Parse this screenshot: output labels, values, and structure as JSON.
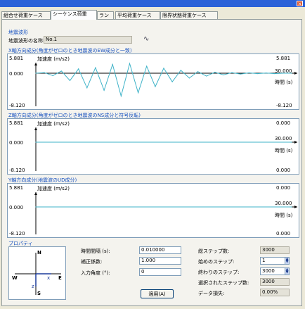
{
  "window": {
    "close_glyph": "✕"
  },
  "tabs": [
    {
      "label": "組合せ荷重ケース"
    },
    {
      "label": "シーケンス荷重"
    },
    {
      "label": "ラン"
    },
    {
      "label": "平均荷重ケース"
    },
    {
      "label": "限界状態荷重ケース"
    }
  ],
  "earthquake": {
    "group_title": "地震波形",
    "name_label": "地震波形の名称:",
    "name_value": "No.1",
    "icon": "waveform-icon"
  },
  "charts": [
    {
      "title": "X軸方向成分(角度がゼロのとき地震波のEW成分と一致)",
      "y_axis_label": "加速度 (m/s2)",
      "x_axis_label": "時間 (s)",
      "y_max_label": "5.881",
      "y_zero_label": "0.000",
      "y_min_label": "-8.120",
      "right_top_label": "5.881",
      "right_bottom_label": "-8.120",
      "x_end_label": "30.000"
    },
    {
      "title": "Z軸方向成分(角度がゼロのとき地震波のNS成分と符号反転)",
      "y_axis_label": "加速度 (m/s2)",
      "x_axis_label": "時間 (s)",
      "y_max_label": "5.881",
      "y_zero_label": "0.000",
      "y_min_label": "-8.120",
      "right_top_label": "0.000",
      "right_bottom_label": "0.000",
      "x_end_label": "30.000"
    },
    {
      "title": "Y軸方向成分(地震波のUD成分)",
      "y_axis_label": "加速度 (m/s2)",
      "x_axis_label": "時間 (s)",
      "y_max_label": "5.881",
      "y_zero_label": "0.000",
      "y_min_label": "-8.120",
      "right_top_label": "0.000",
      "right_bottom_label": "0.000",
      "x_end_label": "30.000"
    }
  ],
  "chart_data": [
    {
      "type": "line",
      "title": "X軸方向成分(角度がゼロのとき地震波のEW成分と一致)",
      "xlabel": "時間 (s)",
      "ylabel": "加速度 (m/s2)",
      "xlim": [
        0,
        30
      ],
      "ylim": [
        -8.12,
        5.881
      ],
      "x": [
        0,
        1,
        2,
        3,
        4,
        5,
        6,
        7,
        8,
        9,
        10,
        11,
        12,
        13,
        14,
        15,
        16,
        17,
        18,
        19,
        20,
        21,
        22,
        23,
        24,
        25,
        26,
        27,
        28,
        29,
        30
      ],
      "series": [
        {
          "values": [
            0,
            0.3,
            -0.6,
            1.2,
            -1.8,
            2.4,
            -3.6,
            3.1,
            -4.2,
            4.9,
            -5.6,
            5.4,
            -4.8,
            3.9,
            -3.3,
            2.8,
            -2.1,
            1.6,
            -1.2,
            0.9,
            -0.7,
            0.5,
            -0.4,
            0.3,
            -0.2,
            0.2,
            -0.1,
            0.1,
            -0.1,
            0,
            0
          ]
        }
      ]
    },
    {
      "type": "line",
      "title": "Z軸方向成分(角度がゼロのとき地震波のNS成分と符号反転)",
      "xlabel": "時間 (s)",
      "ylabel": "加速度 (m/s2)",
      "xlim": [
        0,
        30
      ],
      "ylim": [
        -8.12,
        5.881
      ],
      "x": [
        0,
        30
      ],
      "series": [
        {
          "values": [
            0,
            0
          ]
        }
      ]
    },
    {
      "type": "line",
      "title": "Y軸方向成分(地震波のUD成分)",
      "xlabel": "時間 (s)",
      "ylabel": "加速度 (m/s2)",
      "xlim": [
        0,
        30
      ],
      "ylim": [
        -8.12,
        5.881
      ],
      "x": [
        0,
        30
      ],
      "series": [
        {
          "values": [
            0,
            0
          ]
        }
      ]
    }
  ],
  "colors": {
    "wave": "#3fb3c8",
    "zero_line": "#3fb3c8",
    "group_title": "#1550c0"
  },
  "property": {
    "group_title": "プロパティ",
    "compass": {
      "n": "N",
      "s": "S",
      "e": "E",
      "w": "W",
      "x": "x",
      "z": "z"
    },
    "time_step_label": "時間間隔 (s):",
    "time_step_value": "0.010000",
    "coef_label": "補正係数:",
    "coef_value": "1.000",
    "angle_label": "入力角度 (°):",
    "angle_value": "0",
    "apply_label": "適用(A)",
    "total_steps_label": "総ステップ数:",
    "total_steps_value": "3000",
    "start_step_label": "始めのステップ:",
    "start_step_value": "1",
    "end_step_label": "終わりのステップ:",
    "end_step_value": "3000",
    "selected_steps_label": "選択されたステップ数:",
    "selected_steps_value": "3000",
    "data_loss_label": "データ損失:",
    "data_loss_value": "0.00%"
  }
}
